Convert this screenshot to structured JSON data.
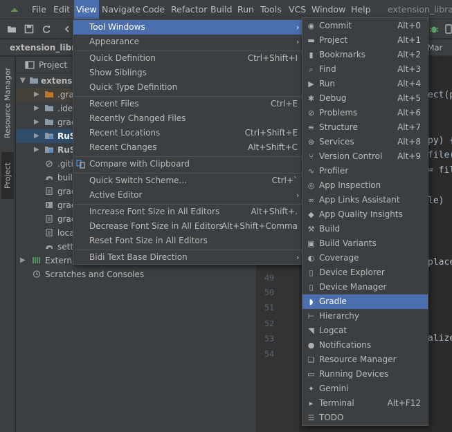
{
  "menubar": {
    "items": [
      {
        "label": "File"
      },
      {
        "label": "Edit"
      },
      {
        "label": "View"
      },
      {
        "label": "Navigate"
      },
      {
        "label": "Code"
      },
      {
        "label": "Refactor"
      },
      {
        "label": "Build"
      },
      {
        "label": "Run"
      },
      {
        "label": "Tools"
      },
      {
        "label": "VCS"
      },
      {
        "label": "Window"
      },
      {
        "label": "Help"
      }
    ],
    "window_title": "extension_librarie"
  },
  "navbar": {
    "project_label": "extension_librari",
    "right_tab": "oidMar"
  },
  "side_strip": {
    "resource_manager": "Resource Manager",
    "project": "Project"
  },
  "project_panel": {
    "header": "Project",
    "rows": [
      {
        "label": "extens"
      },
      {
        "label": ".gra"
      },
      {
        "label": ".ide"
      },
      {
        "label": "grac"
      },
      {
        "label": "RuS"
      },
      {
        "label": "RuS"
      },
      {
        "label": ".giti"
      },
      {
        "label": "buil"
      },
      {
        "label": "grac"
      },
      {
        "label": "grac"
      },
      {
        "label": "grac"
      },
      {
        "label": "loca"
      },
      {
        "label": "sett"
      },
      {
        "label": "Externa"
      },
      {
        "label": "Scratches and Consoles"
      }
    ]
  },
  "editor": {
    "line_numbers": [
      "48",
      "49",
      "50",
      "51",
      "52",
      "53",
      "54"
    ],
    "code_fragments": [
      "ect(p",
      "py) {",
      "file(",
      "= fil",
      "le)",
      "place",
      "alize"
    ]
  },
  "view_menu": {
    "items": [
      {
        "label": "Tool Windows",
        "shortcut": ""
      },
      {
        "label": "Appearance",
        "shortcut": ""
      },
      {
        "label": "Quick Definition",
        "shortcut": "Ctrl+Shift+I"
      },
      {
        "label": "Show Siblings",
        "shortcut": ""
      },
      {
        "label": "Quick Type Definition",
        "shortcut": ""
      },
      {
        "label": "Recent Files",
        "shortcut": "Ctrl+E"
      },
      {
        "label": "Recently Changed Files",
        "shortcut": ""
      },
      {
        "label": "Recent Locations",
        "shortcut": "Ctrl+Shift+E"
      },
      {
        "label": "Recent Changes",
        "shortcut": "Alt+Shift+C"
      },
      {
        "label": "Compare with Clipboard",
        "shortcut": ""
      },
      {
        "label": "Quick Switch Scheme...",
        "shortcut": "Ctrl+`"
      },
      {
        "label": "Active Editor",
        "shortcut": ""
      },
      {
        "label": "Increase Font Size in All Editors",
        "shortcut": "Alt+Shift+."
      },
      {
        "label": "Decrease Font Size in All Editors",
        "shortcut": "Alt+Shift+Comma"
      },
      {
        "label": "Reset Font Size in All Editors",
        "shortcut": ""
      },
      {
        "label": "Bidi Text Base Direction",
        "shortcut": ""
      }
    ]
  },
  "tool_windows_menu": {
    "items": [
      {
        "label": "Commit",
        "shortcut": "Alt+0",
        "icon": "commit-icon"
      },
      {
        "label": "Project",
        "shortcut": "Alt+1",
        "icon": "project-icon"
      },
      {
        "label": "Bookmarks",
        "shortcut": "Alt+2",
        "icon": "bookmarks-icon"
      },
      {
        "label": "Find",
        "shortcut": "Alt+3",
        "icon": "find-icon"
      },
      {
        "label": "Run",
        "shortcut": "Alt+4",
        "icon": "run-icon"
      },
      {
        "label": "Debug",
        "shortcut": "Alt+5",
        "icon": "debug-icon"
      },
      {
        "label": "Problems",
        "shortcut": "Alt+6",
        "icon": "problems-icon"
      },
      {
        "label": "Structure",
        "shortcut": "Alt+7",
        "icon": "structure-icon"
      },
      {
        "label": "Services",
        "shortcut": "Alt+8",
        "icon": "services-icon"
      },
      {
        "label": "Version Control",
        "shortcut": "Alt+9",
        "icon": "version-control-icon"
      },
      {
        "label": "Profiler",
        "shortcut": "",
        "icon": "profiler-icon"
      },
      {
        "label": "App Inspection",
        "shortcut": "",
        "icon": "app-inspection-icon"
      },
      {
        "label": "App Links Assistant",
        "shortcut": "",
        "icon": "app-links-icon"
      },
      {
        "label": "App Quality Insights",
        "shortcut": "",
        "icon": "app-quality-icon"
      },
      {
        "label": "Build",
        "shortcut": "",
        "icon": "build-icon"
      },
      {
        "label": "Build Variants",
        "shortcut": "",
        "icon": "build-variants-icon"
      },
      {
        "label": "Coverage",
        "shortcut": "",
        "icon": "coverage-icon"
      },
      {
        "label": "Device Explorer",
        "shortcut": "",
        "icon": "device-explorer-icon"
      },
      {
        "label": "Device Manager",
        "shortcut": "",
        "icon": "device-manager-icon"
      },
      {
        "label": "Gradle",
        "shortcut": "",
        "icon": "gradle-icon"
      },
      {
        "label": "Hierarchy",
        "shortcut": "",
        "icon": "hierarchy-icon"
      },
      {
        "label": "Logcat",
        "shortcut": "",
        "icon": "logcat-icon"
      },
      {
        "label": "Notifications",
        "shortcut": "",
        "icon": "notifications-icon"
      },
      {
        "label": "Resource Manager",
        "shortcut": "",
        "icon": "resource-manager-icon"
      },
      {
        "label": "Running Devices",
        "shortcut": "",
        "icon": "running-devices-icon"
      },
      {
        "label": "Gemini",
        "shortcut": "",
        "icon": "gemini-icon"
      },
      {
        "label": "Terminal",
        "shortcut": "Alt+F12",
        "icon": "terminal-icon"
      },
      {
        "label": "TODO",
        "shortcut": "",
        "icon": "todo-icon"
      }
    ]
  },
  "colors": {
    "highlight": "#4b6eaf",
    "menu_bg": "#3c3f41",
    "editor_bg": "#2b2b2b"
  }
}
